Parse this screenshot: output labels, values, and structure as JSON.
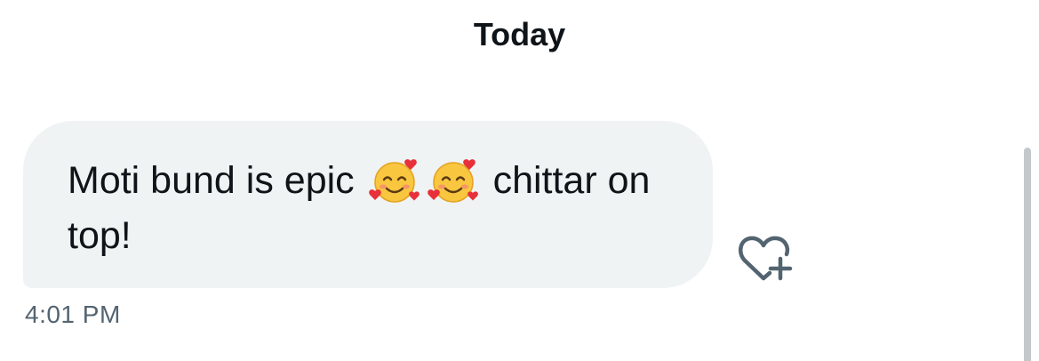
{
  "conversation": {
    "date_header": "Today",
    "message": {
      "text_before_emoji": "Moti bund is epic ",
      "emoji_1": "smiling-face-with-hearts",
      "emoji_2": "smiling-face-with-hearts",
      "text_after_emoji": " chittar on top!",
      "timestamp": "4:01 PM"
    },
    "actions": {
      "react_icon": "heart-plus-icon"
    }
  },
  "colors": {
    "bubble_bg": "#eff3f4",
    "text": "#0f1419",
    "muted": "#536471",
    "emoji_face": "#f9c640",
    "emoji_heart": "#e8303a"
  }
}
